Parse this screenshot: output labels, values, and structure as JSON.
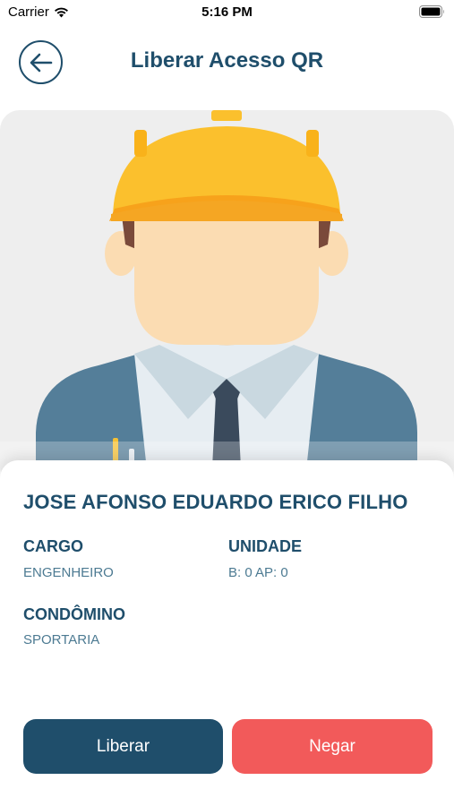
{
  "status_bar": {
    "carrier": "Carrier",
    "time": "5:16 PM"
  },
  "header": {
    "title": "Liberar Acesso QR",
    "back_icon": "arrow-left-icon"
  },
  "photo": {
    "icon": "worker-avatar-icon",
    "background": "#eeeeee"
  },
  "person": {
    "name": "JOSE AFONSO EDUARDO ERICO FILHO",
    "fields": {
      "cargo": {
        "label": "CARGO",
        "value": "ENGENHEIRO"
      },
      "unidade": {
        "label": "UNIDADE",
        "value": "B: 0 AP: 0"
      },
      "condomino": {
        "label": "CONDÔMINO",
        "value": "SPORTARIA"
      }
    }
  },
  "actions": {
    "approve_label": "Liberar",
    "deny_label": "Negar"
  },
  "colors": {
    "primary": "#1f4e6b",
    "danger": "#f25a5a",
    "muted_text": "#4c7a92"
  }
}
